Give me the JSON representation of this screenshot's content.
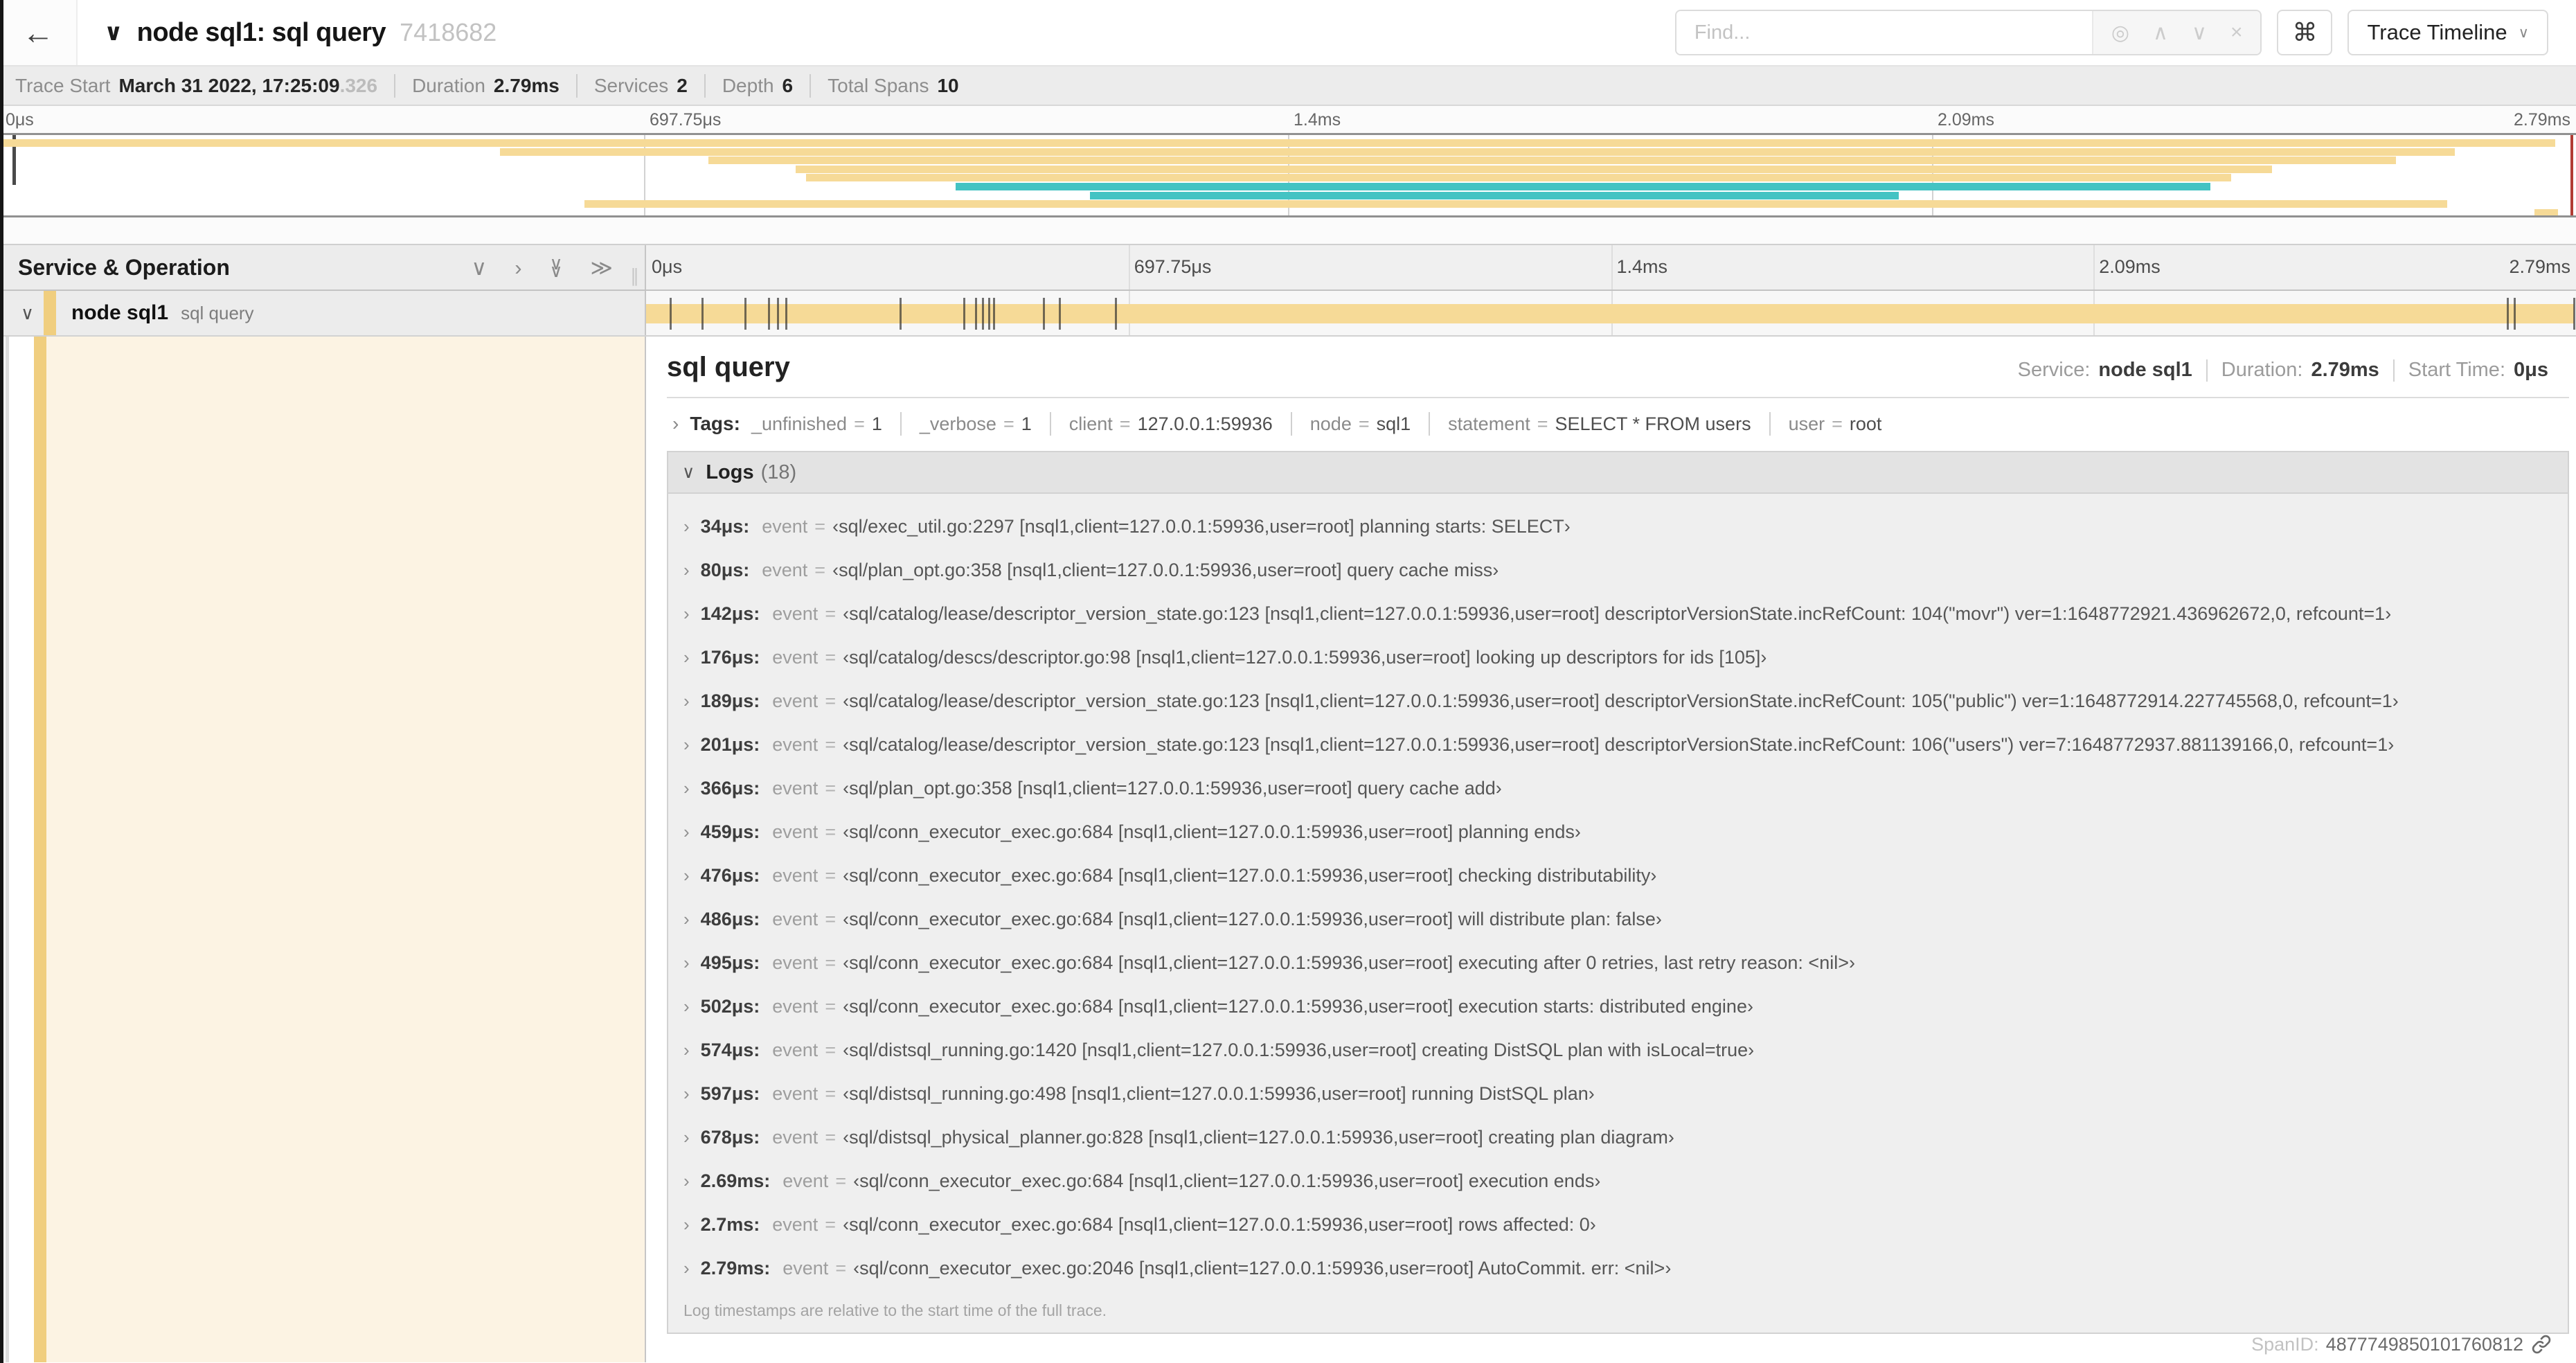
{
  "colors": {
    "accent_tan": "#F6DA97",
    "accent_teal": "#43C3C3",
    "stripe_tan": "#F0CE7F",
    "detail_bg_cream": "#FCF3E3",
    "scrubber_red": "#B23B33"
  },
  "icons": {
    "back_arrow": "←",
    "chevron_down": "∨",
    "chevron_right": "›",
    "chevrons_right": "≫",
    "caret_up": "∧",
    "cross": "×",
    "bullseye": "◎",
    "command": "⌘",
    "grip": "∥"
  },
  "header": {
    "title": "node sql1: sql query",
    "trace_id": "7418682",
    "find_placeholder": "Find...",
    "view_select_label": "Trace Timeline"
  },
  "trace_info": {
    "items": [
      {
        "label": "Trace Start",
        "value": "March 31 2022, 17:25:09",
        "suffix": ".326"
      },
      {
        "label": "Duration",
        "value": "2.79ms"
      },
      {
        "label": "Services",
        "value": "2"
      },
      {
        "label": "Depth",
        "value": "6"
      },
      {
        "label": "Total Spans",
        "value": "10"
      }
    ]
  },
  "minimap": {
    "axis_ticks": [
      "0μs",
      "697.75μs",
      "1.4ms",
      "2.09ms",
      "2.79ms"
    ],
    "spans": [
      {
        "start": 0,
        "end": 99.2,
        "color": "tan"
      },
      {
        "start": 19.4,
        "end": 95.3,
        "color": "tan"
      },
      {
        "start": 27.5,
        "end": 93.0,
        "color": "tan"
      },
      {
        "start": 30.9,
        "end": 88.2,
        "color": "tan"
      },
      {
        "start": 31.3,
        "end": 86.6,
        "color": "tan"
      },
      {
        "start": 37.1,
        "end": 85.8,
        "color": "teal"
      },
      {
        "start": 42.3,
        "end": 73.7,
        "color": "teal"
      },
      {
        "start": 22.7,
        "end": 95.0,
        "color": "tan"
      },
      {
        "start": 98.4,
        "end": 99.3,
        "color": "tan"
      }
    ]
  },
  "timeline": {
    "col_header": "Service & Operation",
    "axis_ticks": [
      "0μs",
      "697.75μs",
      "1.4ms",
      "2.09ms",
      "2.79ms"
    ]
  },
  "span_row": {
    "service": "node sql1",
    "operation": "sql query",
    "log_marker_pcts": [
      1.22,
      2.87,
      5.09,
      6.31,
      6.77,
      7.2,
      13.12,
      16.45,
      17.06,
      17.42,
      17.74,
      17.99,
      20.57,
      21.4,
      24.3,
      96.42,
      96.77,
      99.85
    ]
  },
  "detail": {
    "title": "sql query",
    "service_label": "Service:",
    "service_value": "node sql1",
    "duration_label": "Duration:",
    "duration_value": "2.79ms",
    "start_label": "Start Time:",
    "start_value": "0μs",
    "tags_label": "Tags:",
    "tags": [
      {
        "key": "_unfinished",
        "value": "1"
      },
      {
        "key": "_verbose",
        "value": "1"
      },
      {
        "key": "client",
        "value": "127.0.0.1:59936"
      },
      {
        "key": "node",
        "value": "sql1"
      },
      {
        "key": "statement",
        "value": "SELECT * FROM users"
      },
      {
        "key": "user",
        "value": "root"
      }
    ],
    "logs_label": "Logs",
    "logs_count": "(18)",
    "logs": [
      {
        "ts": "34μs:",
        "key": "event",
        "value": "‹sql/exec_util.go:2297 [nsql1,client=127.0.0.1:59936,user=root] planning starts: SELECT›"
      },
      {
        "ts": "80μs:",
        "key": "event",
        "value": "‹sql/plan_opt.go:358 [nsql1,client=127.0.0.1:59936,user=root] query cache miss›"
      },
      {
        "ts": "142μs:",
        "key": "event",
        "value": "‹sql/catalog/lease/descriptor_version_state.go:123 [nsql1,client=127.0.0.1:59936,user=root] descriptorVersionState.incRefCount: 104(\"movr\") ver=1:1648772921.436962672,0, refcount=1›"
      },
      {
        "ts": "176μs:",
        "key": "event",
        "value": "‹sql/catalog/descs/descriptor.go:98 [nsql1,client=127.0.0.1:59936,user=root] looking up descriptors for ids [105]›"
      },
      {
        "ts": "189μs:",
        "key": "event",
        "value": "‹sql/catalog/lease/descriptor_version_state.go:123 [nsql1,client=127.0.0.1:59936,user=root] descriptorVersionState.incRefCount: 105(\"public\") ver=1:1648772914.227745568,0, refcount=1›"
      },
      {
        "ts": "201μs:",
        "key": "event",
        "value": "‹sql/catalog/lease/descriptor_version_state.go:123 [nsql1,client=127.0.0.1:59936,user=root] descriptorVersionState.incRefCount: 106(\"users\") ver=7:1648772937.881139166,0, refcount=1›"
      },
      {
        "ts": "366μs:",
        "key": "event",
        "value": "‹sql/plan_opt.go:358 [nsql1,client=127.0.0.1:59936,user=root] query cache add›"
      },
      {
        "ts": "459μs:",
        "key": "event",
        "value": "‹sql/conn_executor_exec.go:684 [nsql1,client=127.0.0.1:59936,user=root] planning ends›"
      },
      {
        "ts": "476μs:",
        "key": "event",
        "value": "‹sql/conn_executor_exec.go:684 [nsql1,client=127.0.0.1:59936,user=root] checking distributability›"
      },
      {
        "ts": "486μs:",
        "key": "event",
        "value": "‹sql/conn_executor_exec.go:684 [nsql1,client=127.0.0.1:59936,user=root] will distribute plan: false›"
      },
      {
        "ts": "495μs:",
        "key": "event",
        "value": "‹sql/conn_executor_exec.go:684 [nsql1,client=127.0.0.1:59936,user=root] executing after 0 retries, last retry reason: <nil>›"
      },
      {
        "ts": "502μs:",
        "key": "event",
        "value": "‹sql/conn_executor_exec.go:684 [nsql1,client=127.0.0.1:59936,user=root] execution starts: distributed engine›"
      },
      {
        "ts": "574μs:",
        "key": "event",
        "value": "‹sql/distsql_running.go:1420 [nsql1,client=127.0.0.1:59936,user=root] creating DistSQL plan with isLocal=true›"
      },
      {
        "ts": "597μs:",
        "key": "event",
        "value": "‹sql/distsql_running.go:498 [nsql1,client=127.0.0.1:59936,user=root] running DistSQL plan›"
      },
      {
        "ts": "678μs:",
        "key": "event",
        "value": "‹sql/distsql_physical_planner.go:828 [nsql1,client=127.0.0.1:59936,user=root] creating plan diagram›"
      },
      {
        "ts": "2.69ms:",
        "key": "event",
        "value": "‹sql/conn_executor_exec.go:684 [nsql1,client=127.0.0.1:59936,user=root] execution ends›"
      },
      {
        "ts": "2.7ms:",
        "key": "event",
        "value": "‹sql/conn_executor_exec.go:684 [nsql1,client=127.0.0.1:59936,user=root] rows affected: 0›"
      },
      {
        "ts": "2.79ms:",
        "key": "event",
        "value": "‹sql/conn_executor_exec.go:2046 [nsql1,client=127.0.0.1:59936,user=root] AutoCommit. err: <nil>›"
      }
    ],
    "footnote": "Log timestamps are relative to the start time of the full trace.",
    "span_id_label": "SpanID:",
    "span_id_value": "4877749850101760812"
  }
}
